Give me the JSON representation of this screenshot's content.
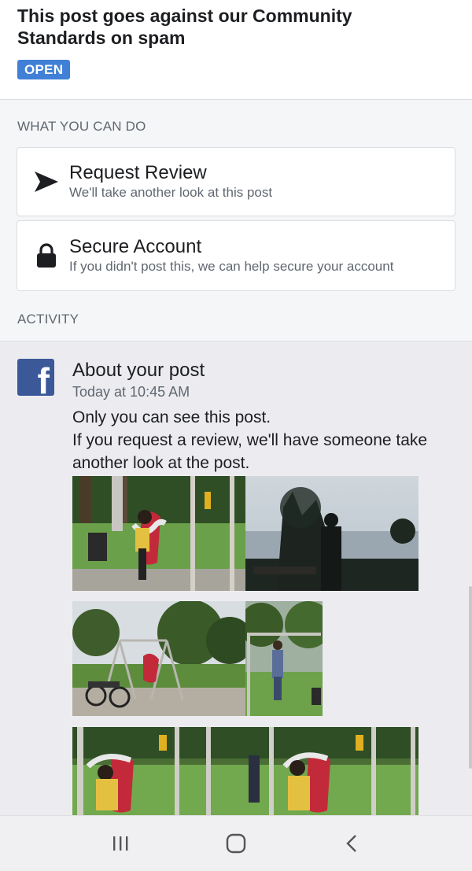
{
  "header": {
    "title": "This post goes against our Community Standards on spam",
    "status_badge": "OPEN"
  },
  "what_you_can_do": {
    "label": "WHAT YOU CAN DO",
    "options": [
      {
        "title": "Request Review",
        "subtitle": "We'll take another look at this post",
        "icon": "send-arrow-icon"
      },
      {
        "title": "Secure Account",
        "subtitle": "If you didn't post this, we can help secure your account",
        "icon": "lock-icon"
      }
    ]
  },
  "activity": {
    "label": "ACTIVITY",
    "item": {
      "icon": "facebook-logo-icon",
      "title": "About your post",
      "time": "Today at 10:45 AM",
      "message_line1": "Only you can see this post.",
      "message_line2": "If you request a review, we'll have someone take",
      "message_line3": "another look at the post."
    },
    "photos_count": 7
  },
  "navbar": {
    "items": [
      "recent-apps-icon",
      "home-icon",
      "back-icon"
    ]
  },
  "colors": {
    "badge": "#4080d6",
    "facebook_blue": "#3b5998",
    "activity_bg": "#ececf0"
  }
}
